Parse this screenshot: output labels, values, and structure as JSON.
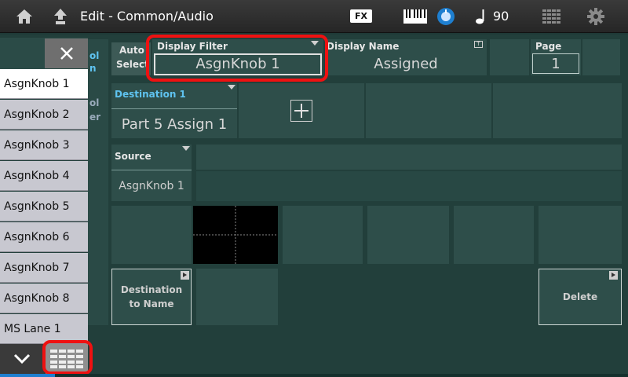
{
  "header": {
    "title": "Edit - Common/Audio",
    "fx_label": "FX",
    "tempo": "90",
    "icons": [
      "home-icon",
      "up-arrow-icon",
      "keyboard-icon",
      "dial-icon",
      "note-icon",
      "grid-icon",
      "gear-icon"
    ]
  },
  "popup": {
    "items": [
      "AsgnKnob 1",
      "AsgnKnob 2",
      "AsgnKnob 3",
      "AsgnKnob 4",
      "AsgnKnob 5",
      "AsgnKnob 6",
      "AsgnKnob 7",
      "AsgnKnob 8",
      "MS Lane 1"
    ],
    "selected": "AsgnKnob 1"
  },
  "background": {
    "partial_labels": [
      "ol",
      "n",
      "ol",
      "er"
    ]
  },
  "controls": {
    "auto_select_line1": "Auto",
    "auto_select_line2": "Select",
    "display_filter_label": "Display Filter",
    "display_filter_value": "AsgnKnob 1",
    "display_name_label": "Display Name",
    "display_name_badge": "T",
    "display_name_value": "Assigned",
    "page_label": "Page",
    "page_value": "1",
    "destination_label": "Destination 1",
    "destination_value": "Part 5 Assign 1",
    "source_label": "Source",
    "source_value": "AsgnKnob 1",
    "dest_to_name_line1": "Destination",
    "dest_to_name_line2": "to Name",
    "delete_label": "Delete"
  },
  "colors": {
    "accent_label": "#5fc3f0",
    "highlight": "#ee1111",
    "panel": "#2e4e4a"
  }
}
